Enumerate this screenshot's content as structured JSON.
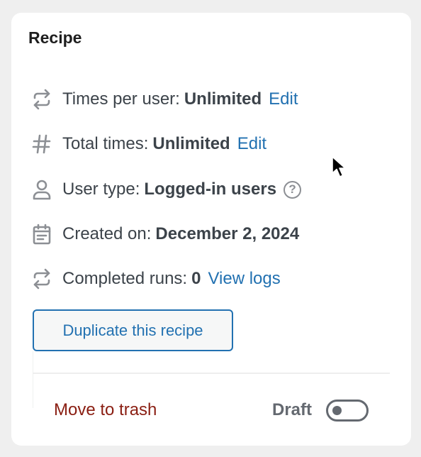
{
  "panel": {
    "title": "Recipe"
  },
  "rows": [
    {
      "icon": "repeat-icon",
      "label": "Times per user:",
      "value": "Unlimited",
      "link": "Edit"
    },
    {
      "icon": "hash-icon",
      "label": "Total times:",
      "value": "Unlimited",
      "link": "Edit"
    },
    {
      "icon": "user-icon",
      "label": "User type:",
      "value": "Logged-in users",
      "help": "?"
    },
    {
      "icon": "calendar-icon",
      "label": "Created on:",
      "value": "December 2, 2024"
    },
    {
      "icon": "repeat-icon",
      "label": "Completed runs:",
      "value": "0",
      "link": "View logs"
    }
  ],
  "actions": {
    "duplicate_label": "Duplicate this recipe",
    "trash_label": "Move to trash",
    "status_label": "Draft",
    "status_toggle_on": false
  },
  "colors": {
    "link": "#2271b1",
    "danger": "#8a1e12",
    "text": "#3c434a",
    "muted": "#646970"
  }
}
